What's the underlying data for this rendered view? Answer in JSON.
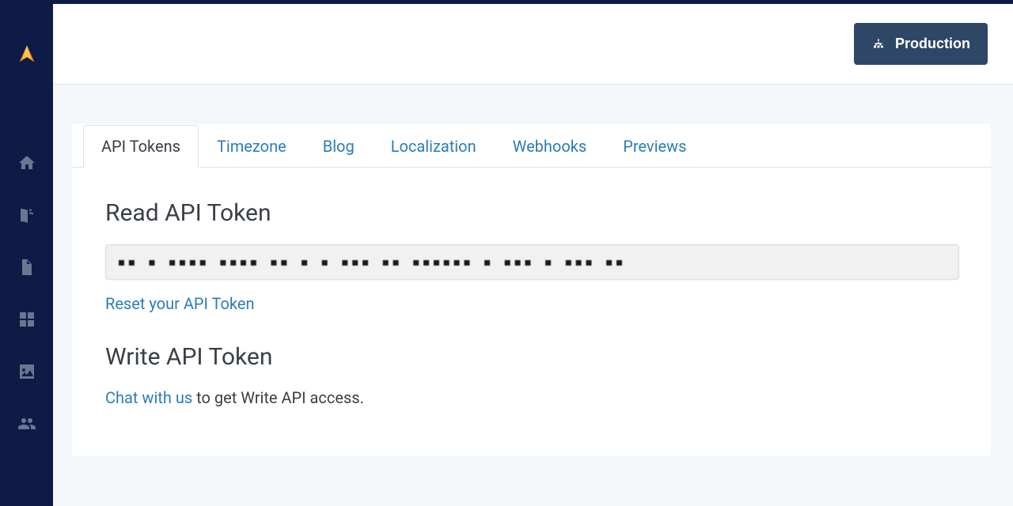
{
  "header": {
    "env_label": "Production"
  },
  "tabs": [
    {
      "label": "API Tokens"
    },
    {
      "label": "Timezone"
    },
    {
      "label": "Blog"
    },
    {
      "label": "Localization"
    },
    {
      "label": "Webhooks"
    },
    {
      "label": "Previews"
    }
  ],
  "read_token": {
    "title": "Read API Token",
    "value": "▪▪ ▪ ▪▪▪▪ ▪▪▪▪ ▪▪ ▪ ▪ ▪▪▪ ▪▪ ▪▪▪▪▪▪ ▪ ▪▪▪ ▪ ▪▪▪  ▪▪",
    "reset_label": "Reset your API Token"
  },
  "write_token": {
    "title": "Write API Token",
    "chat_label": "Chat with us",
    "rest": " to get Write API access."
  }
}
